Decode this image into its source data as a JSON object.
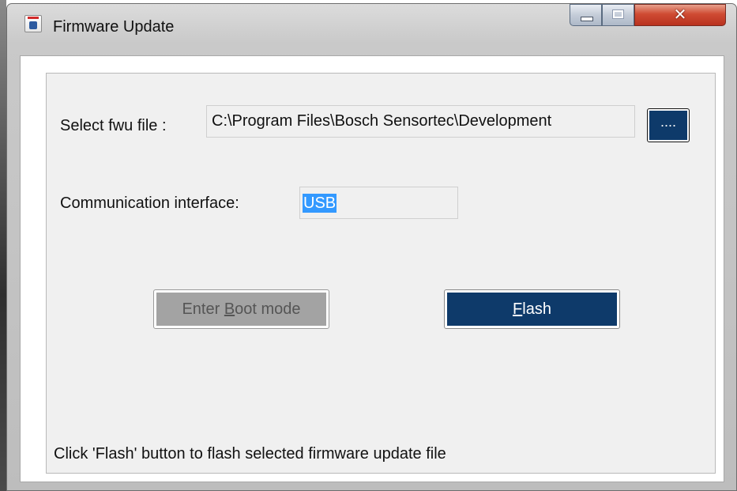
{
  "window": {
    "title": "Firmware Update",
    "close_glyph": "✕",
    "icon": "bosch-app-icon"
  },
  "form": {
    "file_label": "Select fwu file :",
    "file_path": "C:\\Program Files\\Bosch Sensortec\\Development",
    "browse_label": "....",
    "interface_label": "Communication interface:",
    "interface_value": "USB"
  },
  "buttons": {
    "boot_prefix": "Enter ",
    "boot_mnemonic": "B",
    "boot_suffix": "oot mode",
    "flash_mnemonic": "F",
    "flash_suffix": "lash"
  },
  "status": {
    "message": "Click 'Flash' button to flash selected firmware update file"
  },
  "colors": {
    "accent": "#0e3a6a",
    "selection": "#3399ff",
    "disabled_button": "#a3a3a3",
    "close_button": "#cf4b33"
  }
}
